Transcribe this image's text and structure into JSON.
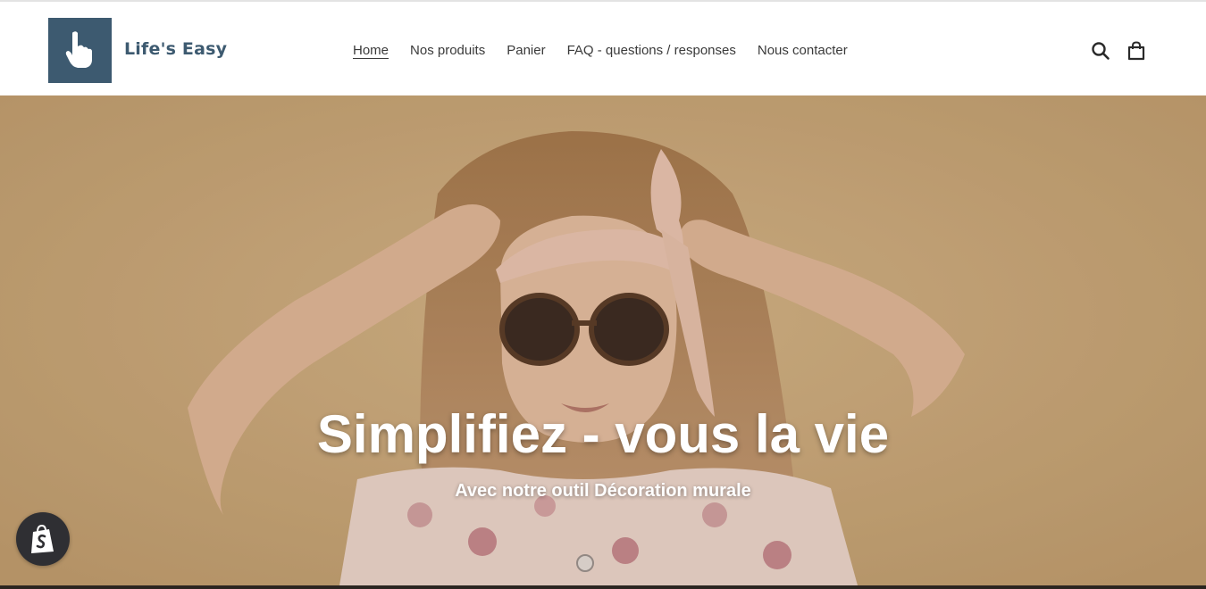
{
  "brand": {
    "name": "Life's Easy",
    "logo_icon": "pointing-hand-icon",
    "accent": "#3d5a70"
  },
  "nav": {
    "items": [
      {
        "label": "Home",
        "active": true
      },
      {
        "label": "Nos produits",
        "active": false
      },
      {
        "label": "Panier",
        "active": false
      },
      {
        "label": "FAQ - questions / responses",
        "active": false
      },
      {
        "label": "Nous contacter",
        "active": false
      }
    ]
  },
  "header_icons": {
    "search": "search-icon",
    "cart": "shopping-bag-icon"
  },
  "hero": {
    "title": "Simplifiez - vous la vie",
    "subtitle": "Avec notre outil Décoration murale",
    "image": "woman-with-headscarf-and-sunglasses-photo"
  },
  "floating_badge": {
    "icon": "shopify-bag-icon"
  }
}
